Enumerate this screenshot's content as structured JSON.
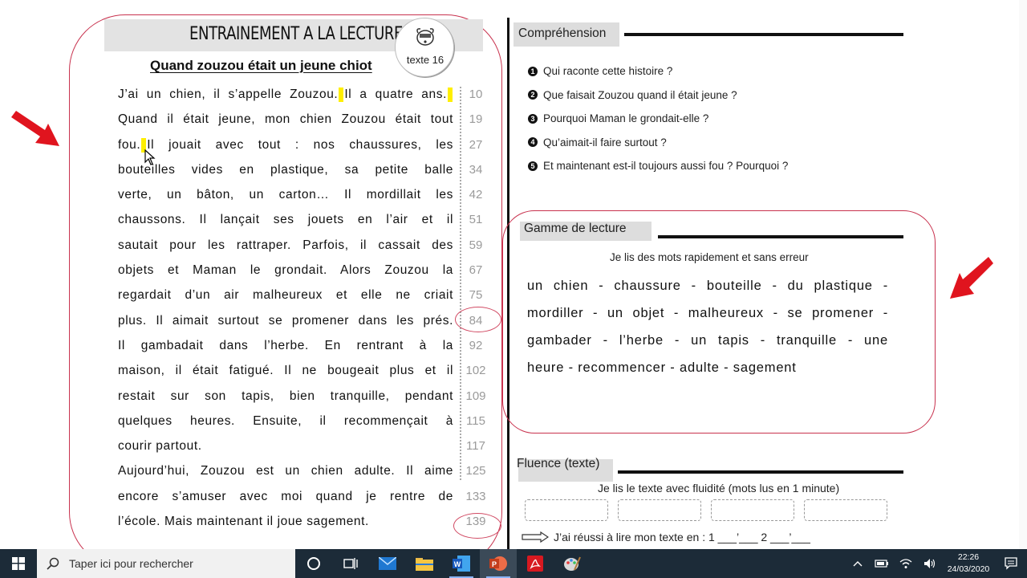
{
  "worksheet": {
    "title": "ENTRAINEMENT A LA LECTURE",
    "badge_label": "texte 16",
    "subtitle": "Quand zouzou était un jeune chiot",
    "reading_lines": [
      {
        "before": "J’ai un chien, il s’appelle Zouzou.",
        "after": "Il a quatre ans.",
        "end_mark": true
      },
      {
        "text": "Quand il était jeune, mon chien Zouzou était tout"
      },
      {
        "before": "fou.",
        "after": "Il jouait avec tout : nos chaussures, les"
      },
      {
        "text": "bouteilles vides en plastique, sa petite balle"
      },
      {
        "text": "verte, un bâton, un carton… Il mordillait les"
      },
      {
        "text": "chaussons. Il lançait ses jouets en l’air et il"
      },
      {
        "text": "sautait pour les rattraper. Parfois, il cassait des"
      },
      {
        "text": "objets et Maman le grondait. Alors Zouzou la"
      },
      {
        "text": "regardait d’un air malheureux et elle ne criait"
      },
      {
        "text": "plus. Il aimait surtout se promener dans les prés."
      },
      {
        "text": "Il gambadait dans l’herbe. En rentrant à la"
      },
      {
        "text": "maison, il était fatigué. Il ne bougeait plus et il"
      },
      {
        "text": "restait sur son tapis, bien tranquille, pendant"
      },
      {
        "text": "quelques heures. Ensuite, il recommençait à"
      },
      {
        "text": "courir partout.",
        "last": true
      },
      {
        "text": "Aujourd’hui, Zouzou est un chien adulte. Il aime"
      },
      {
        "text": "encore s’amuser avec moi quand je rentre de"
      },
      {
        "text": "l’école. Mais maintenant il joue sagement.",
        "last": true
      }
    ],
    "word_counts": [
      "10",
      "19",
      "27",
      "34",
      "42",
      "51",
      "59",
      "67",
      "75",
      "84",
      "92",
      "102",
      "109",
      "115",
      "117",
      "125",
      "133",
      "139"
    ],
    "comprehension": {
      "title": "Compréhension",
      "questions": [
        "Qui raconte cette histoire ?",
        "Que faisait Zouzou quand il était jeune ?",
        "Pourquoi Maman le grondait-elle ?",
        "Qu’aimait-il faire surtout ?",
        "Et maintenant est-il toujours aussi fou ? Pourquoi ?"
      ]
    },
    "gamme": {
      "title": "Gamme de lecture",
      "instruction": "Je lis des mots rapidement et sans erreur",
      "lines": [
        "un chien - chaussure - bouteille - du plastique -",
        "mordiller - un objet - malheureux - se promener -",
        "gambader - l’herbe - un tapis - tranquille - une",
        "heure - recommencer - adulte - sagement"
      ]
    },
    "fluence": {
      "title": "Fluence (texte)",
      "instruction": "Je lis le texte avec fluidité   (mots lus en 1 minute)",
      "result_text": "J’ai réussi à lire mon texte en : 1 ___’___     2 ___’___"
    },
    "colors": {
      "highlight": "#ffef00",
      "annotation_red": "#e0141e",
      "circle_red": "#c8324e"
    }
  },
  "taskbar": {
    "search_placeholder": "Taper ici pour rechercher",
    "time": "22:26",
    "date": "24/03/2020",
    "apps": [
      "cortana-icon",
      "task-view-icon",
      "mail-icon",
      "file-explorer-icon",
      "word-icon",
      "powerpoint-icon",
      "acrobat-icon",
      "paint-icon"
    ]
  }
}
